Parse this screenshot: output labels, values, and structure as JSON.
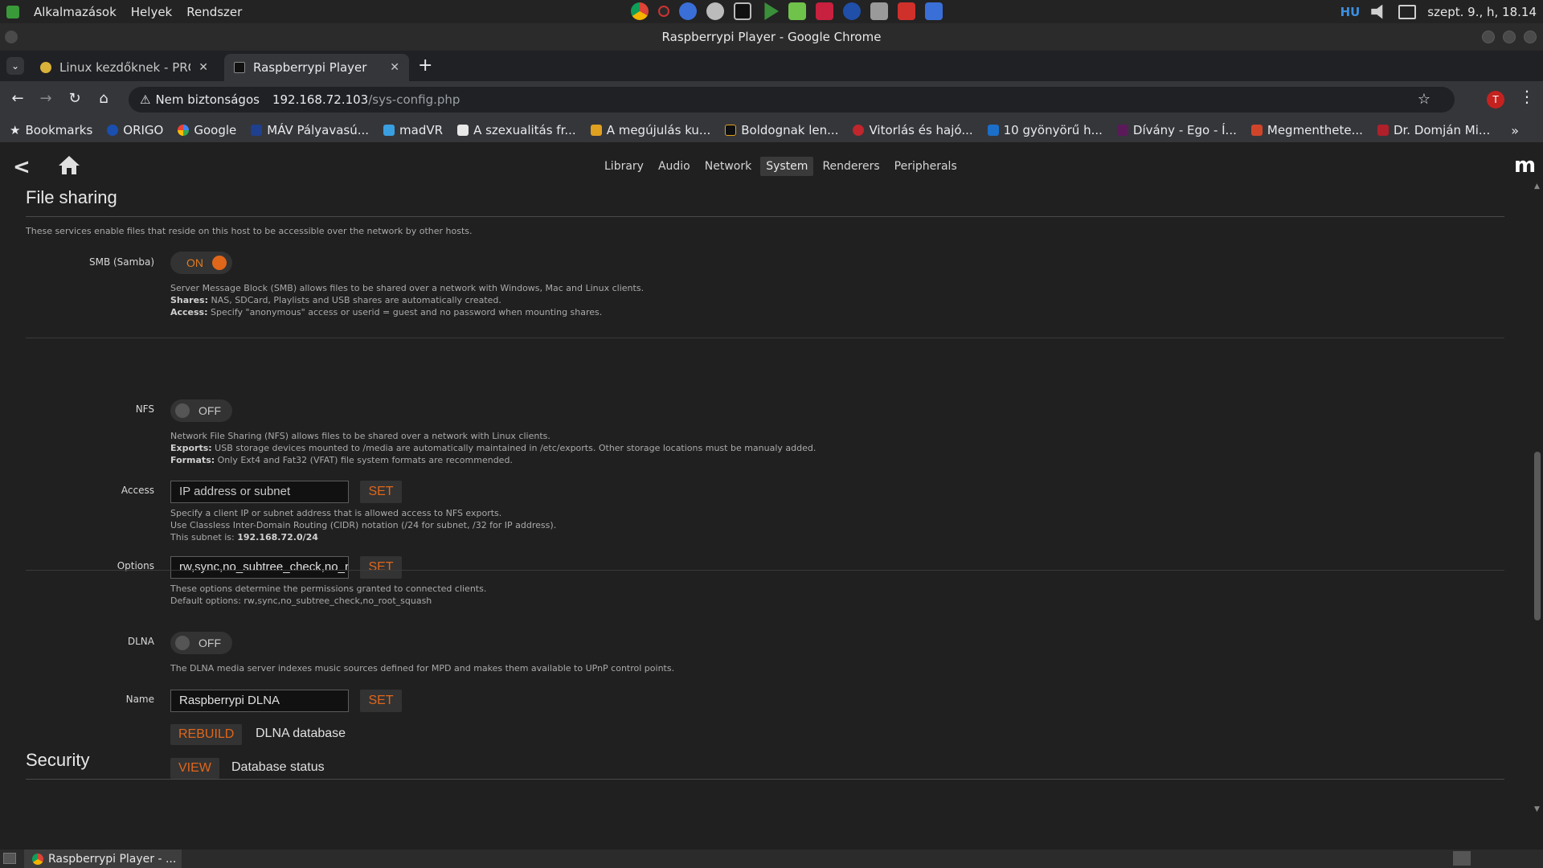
{
  "system_panel": {
    "menu": [
      "Alkalmazások",
      "Helyek",
      "Rendszer"
    ],
    "language": "HU",
    "clock": "szept. 9., h, 18.14"
  },
  "window": {
    "title": "Raspberrypi Player - Google Chrome"
  },
  "browser": {
    "tabs": [
      {
        "title": "Linux kezdőknek - PROHA"
      },
      {
        "title": "Raspberrypi Player"
      }
    ],
    "address": {
      "security": "Nem biztonságos",
      "host": "192.168.72.103",
      "path": "/sys-config.php"
    },
    "profile_initial": "T",
    "bookmarks": [
      {
        "label": "Bookmarks",
        "color": "#e8eaed"
      },
      {
        "label": "ORIGO",
        "color": "#1a4fb0"
      },
      {
        "label": "Google",
        "color": "#4285f4"
      },
      {
        "label": "MÁV Pályavasú...",
        "color": "#1f3f8f"
      },
      {
        "label": "madVR",
        "color": "#3a9fe0"
      },
      {
        "label": "A szexualitás fr...",
        "color": "#e8e8e8"
      },
      {
        "label": "A megújulás ku...",
        "color": "#e0a020"
      },
      {
        "label": "Boldognak len...",
        "color": "#101010"
      },
      {
        "label": "Vitorlás és hajó...",
        "color": "#c0262c"
      },
      {
        "label": "10 gyönyörű h...",
        "color": "#1b6fc8"
      },
      {
        "label": "Dívány - Ego - Í...",
        "color": "#5a1a5a"
      },
      {
        "label": "Megmenthete...",
        "color": "#d0452a"
      },
      {
        "label": "Dr. Domján Mi...",
        "color": "#b0202a"
      }
    ]
  },
  "page": {
    "nav_tabs": [
      "Library",
      "Audio",
      "Network",
      "System",
      "Renderers",
      "Peripherals"
    ],
    "active_tab": "System",
    "logo": "m",
    "file_sharing": {
      "title": "File sharing",
      "intro": "These services enable files that reside on this host to be accessible over the network by other hosts.",
      "smb": {
        "label": "SMB (Samba)",
        "state": "ON",
        "help1": "Server Message Block (SMB) allows files to be shared over a network with Windows, Mac and Linux clients.",
        "help2_bold": "Shares:",
        "help2": " NAS, SDCard, Playlists and USB shares are automatically created.",
        "help3_bold": "Access:",
        "help3": " Specify \"anonymous\" access or userid = guest and no password when mounting shares."
      },
      "nfs": {
        "label": "NFS",
        "state": "OFF",
        "help1": "Network File Sharing (NFS) allows files to be shared over a network with Linux clients.",
        "help2_bold": "Exports:",
        "help2": " USB storage devices mounted to /media are automatically maintained in /etc/exports. Other storage locations must be manualy added.",
        "help3_bold": "Formats:",
        "help3": " Only Ext4 and Fat32 (VFAT) file system formats are recommended.",
        "access_label": "Access",
        "access_placeholder": "IP address or subnet",
        "access_help1": "Specify a client IP or subnet address that is allowed access to NFS exports.",
        "access_help2": "Use Classless Inter-Domain Routing (CIDR) notation (/24 for subnet, /32 for IP address).",
        "access_help3": "This subnet is: ",
        "subnet": "192.168.72.0/24",
        "options_label": "Options",
        "options_value": "rw,sync,no_subtree_check,no_root_squash",
        "options_help1": "These options determine the permissions granted to connected clients.",
        "options_help2": "Default options: rw,sync,no_subtree_check,no_root_squash"
      },
      "dlna": {
        "label": "DLNA",
        "state": "OFF",
        "help": "The DLNA media server indexes music sources defined for MPD and makes them available to UPnP control points.",
        "name_label": "Name",
        "name_value": "Raspberrypi DLNA",
        "rebuild_btn": "REBUILD",
        "rebuild_label": "DLNA database",
        "view_btn": "VIEW",
        "view_label": "Database status"
      },
      "set_btn": "SET"
    },
    "security": {
      "title": "Security"
    }
  },
  "taskbar": {
    "item": "Raspberrypi Player - ..."
  },
  "colors": {
    "accent": "#e0661a",
    "background": "#202020"
  }
}
